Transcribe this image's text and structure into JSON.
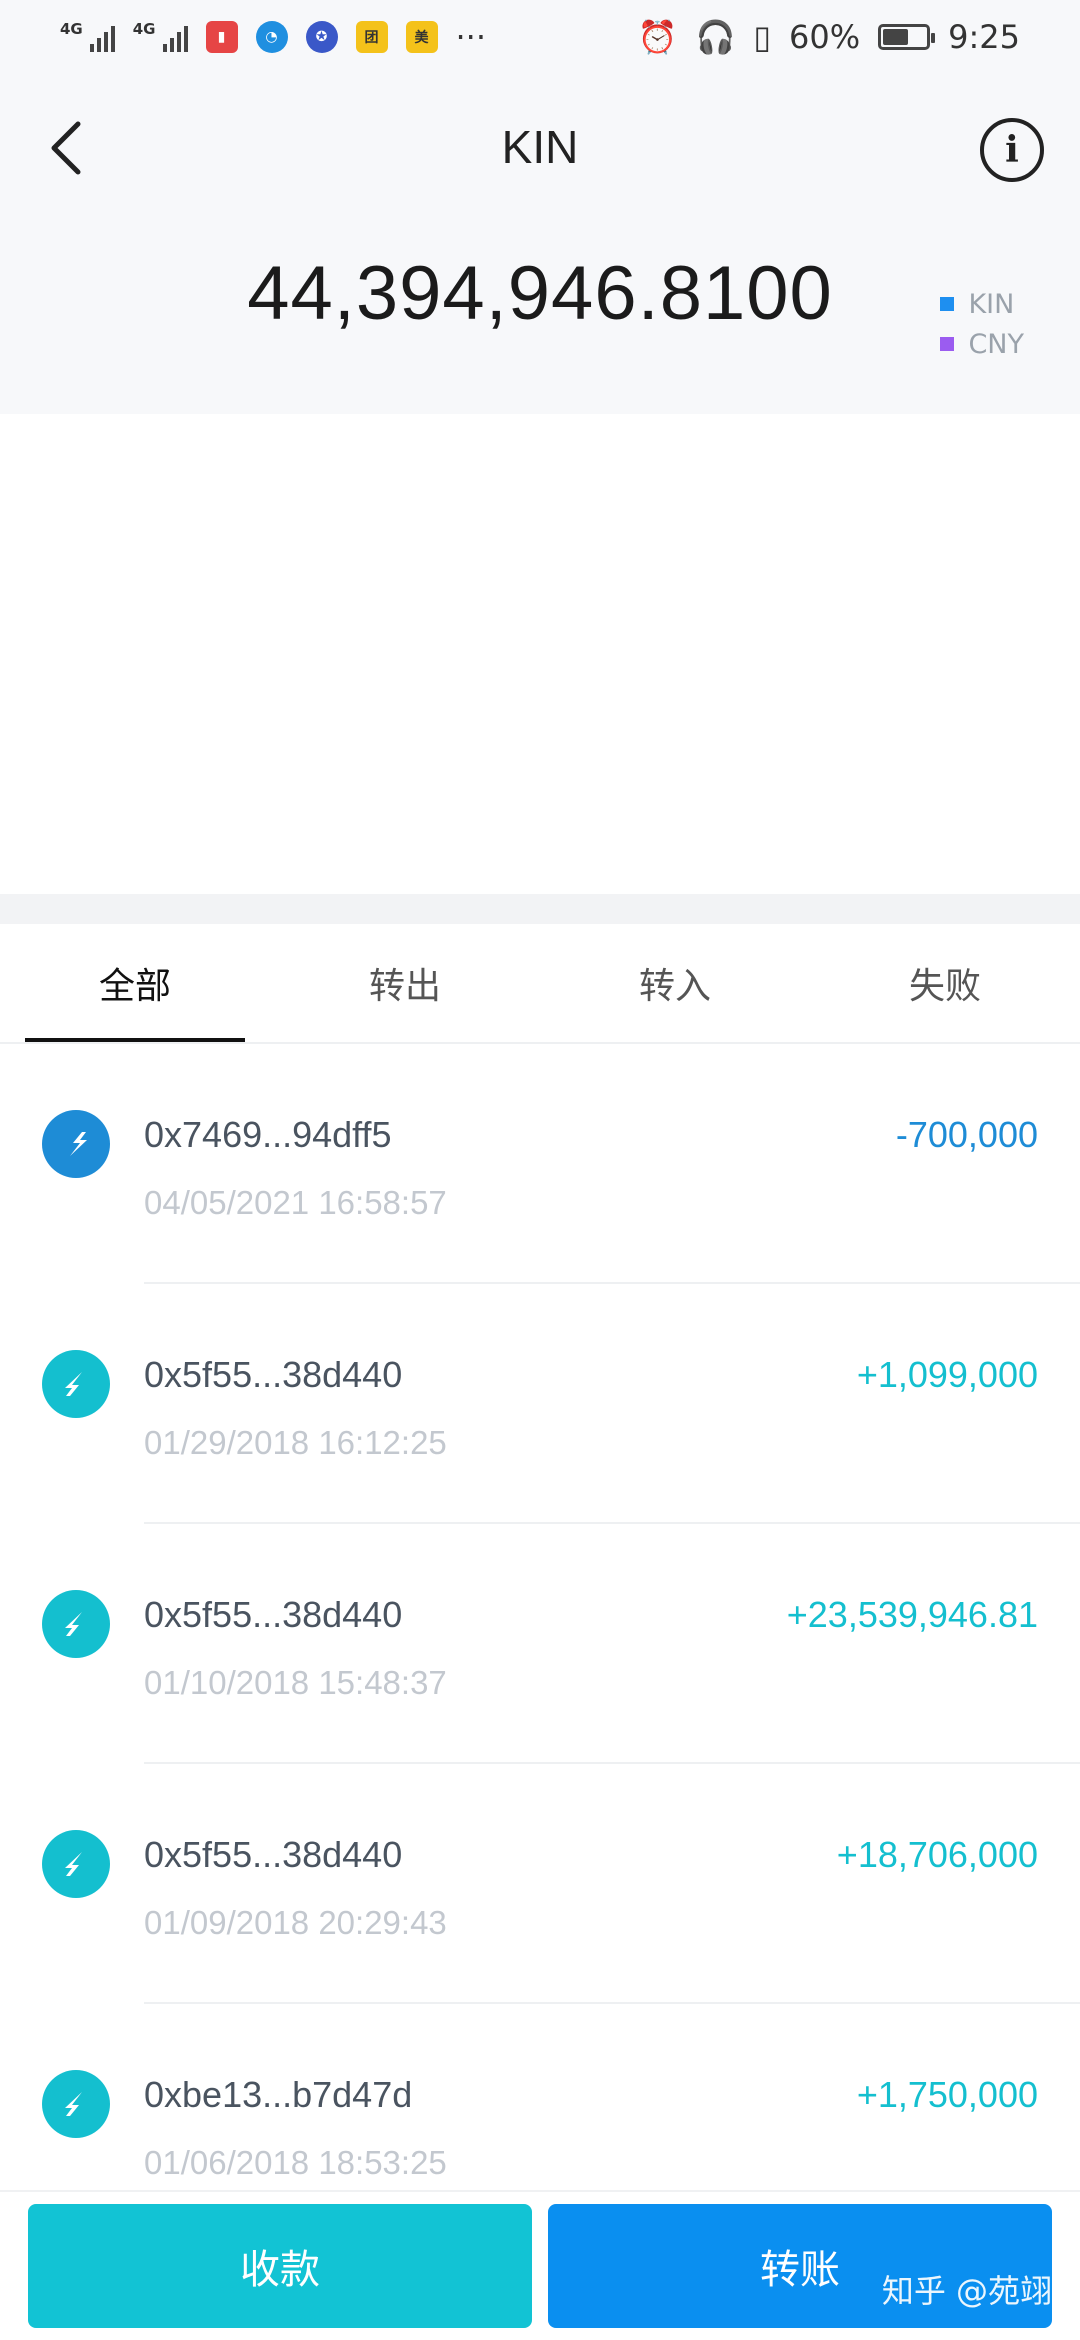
{
  "status_bar": {
    "network1": "4G",
    "network2": "4G",
    "more": "···",
    "battery_text": "60%",
    "time": "9:25",
    "battery_level": 0.6
  },
  "header": {
    "title": "KIN",
    "balance": "44,394,946.8100",
    "legend": [
      {
        "label": "KIN",
        "color": "#1e8ff0"
      },
      {
        "label": "CNY",
        "color": "#9b5cf0"
      }
    ],
    "back_icon": "chevron-left-icon",
    "info_icon": "info-icon"
  },
  "tabs": [
    {
      "label": "全部",
      "active": true
    },
    {
      "label": "转出",
      "active": false
    },
    {
      "label": "转入",
      "active": false
    },
    {
      "label": "失败",
      "active": false
    }
  ],
  "transactions": [
    {
      "direction": "out",
      "address": "0x7469...94dff5",
      "time": "04/05/2021 16:58:57",
      "amount": "-700,000"
    },
    {
      "direction": "in",
      "address": "0x5f55...38d440",
      "time": "01/29/2018 16:12:25",
      "amount": "+1,099,000"
    },
    {
      "direction": "in",
      "address": "0x5f55...38d440",
      "time": "01/10/2018 15:48:37",
      "amount": "+23,539,946.81"
    },
    {
      "direction": "in",
      "address": "0x5f55...38d440",
      "time": "01/09/2018 20:29:43",
      "amount": "+18,706,000"
    },
    {
      "direction": "in",
      "address": "0xbe13...b7d47d",
      "time": "01/06/2018 18:53:25",
      "amount": "+1,750,000"
    }
  ],
  "colors": {
    "out": "#1e8cd6",
    "in": "#14bfcf"
  },
  "actions": {
    "receive_label": "收款",
    "transfer_label": "转账"
  },
  "watermark": "知乎 @苑翊"
}
